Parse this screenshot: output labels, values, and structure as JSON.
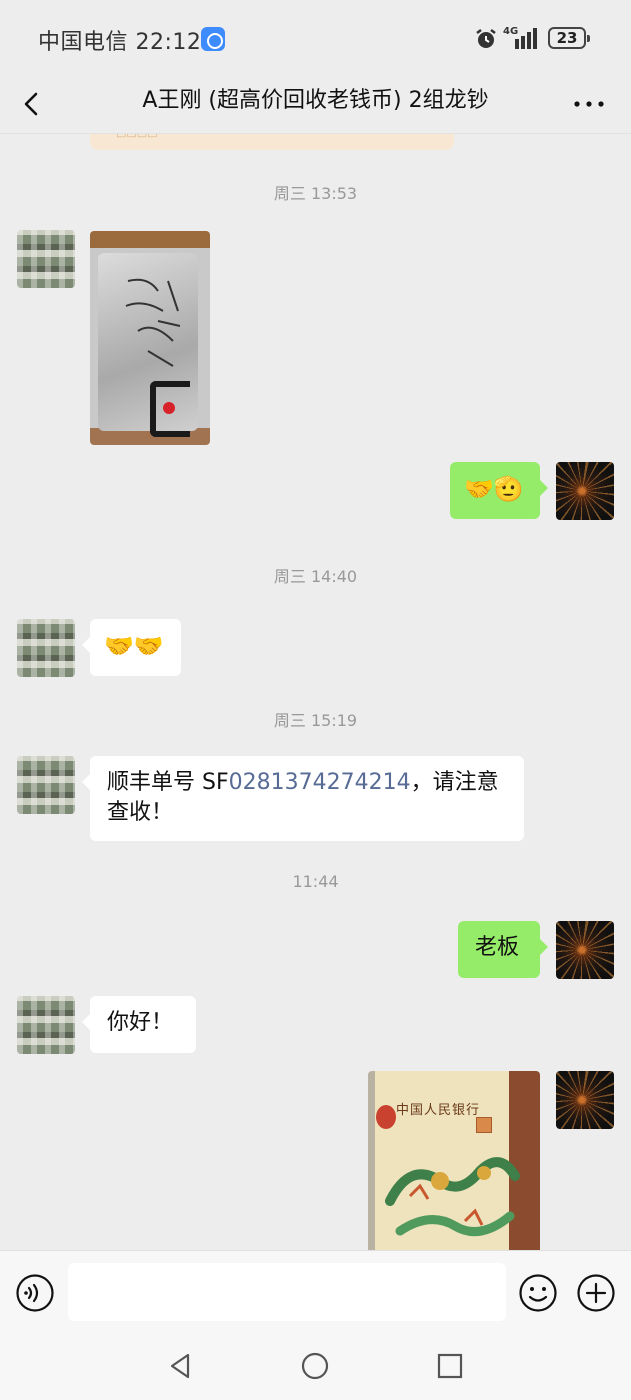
{
  "status_bar": {
    "carrier_time": "中国电信 22:12",
    "network": "4G",
    "battery": "23"
  },
  "header": {
    "title": "A王刚 (超高价回收老钱币) 2组龙钞"
  },
  "messages": [
    {
      "type": "timestamp",
      "text": "周三 13:53"
    },
    {
      "type": "image",
      "sender": "contact",
      "description": "parcel photo"
    },
    {
      "type": "text",
      "sender": "self",
      "text": "🤝🫡"
    },
    {
      "type": "timestamp",
      "text": "周三 14:40"
    },
    {
      "type": "text",
      "sender": "contact",
      "text": "🤝🤝"
    },
    {
      "type": "timestamp",
      "text": "周三 15:19"
    },
    {
      "type": "text",
      "sender": "contact",
      "prefix": "顺丰单号 SF",
      "tracking_number": "0281374274214",
      "suffix": "，请注意",
      "line2": "查收！"
    },
    {
      "type": "timestamp",
      "text": "11:44"
    },
    {
      "type": "text",
      "sender": "self",
      "text": "老板"
    },
    {
      "type": "text",
      "sender": "contact",
      "text": "你好！"
    },
    {
      "type": "image",
      "sender": "self",
      "caption_text": "中国人民银行"
    }
  ],
  "input_bar": {
    "placeholder": ""
  },
  "colors": {
    "background": "#ededed",
    "incoming_bubble": "#ffffff",
    "outgoing_bubble": "#95ec69",
    "link": "#576b95",
    "timestamp": "#999999"
  },
  "icons": {
    "back": "chevron-left-icon",
    "more": "ellipsis-icon",
    "voice": "voice-icon",
    "emoji": "smiley-icon",
    "plus": "plus-icon"
  }
}
